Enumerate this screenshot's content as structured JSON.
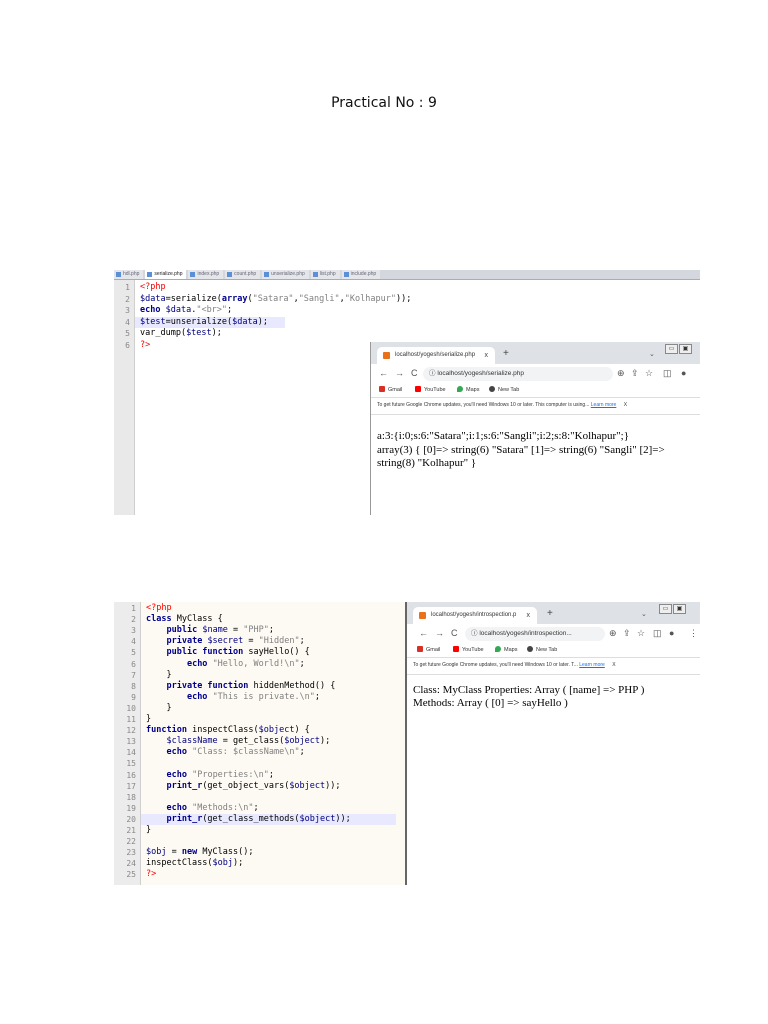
{
  "page": {
    "title": "Practical No : 9"
  },
  "shot1": {
    "editor": {
      "tabs": [
        "hdl.php",
        "serialize.php",
        "index.php",
        "count.php",
        "unserialize.php",
        "list.php",
        "include.php"
      ],
      "active_tab_index": 1,
      "highlight_line": 4,
      "lines": [
        [
          [
            "tag",
            "<?php"
          ]
        ],
        [
          [
            "var",
            "$data"
          ],
          [
            "fn",
            "=serialize("
          ],
          [
            "kw",
            "array"
          ],
          [
            "fn",
            "("
          ],
          [
            "str",
            "\"Satara\""
          ],
          [
            "fn",
            ","
          ],
          [
            "str",
            "\"Sangli\""
          ],
          [
            "fn",
            ","
          ],
          [
            "str",
            "\"Kolhapur\""
          ],
          [
            "fn",
            "));"
          ]
        ],
        [
          [
            "kw",
            "echo"
          ],
          [
            "fn",
            " "
          ],
          [
            "var",
            "$data"
          ],
          [
            "fn",
            "."
          ],
          [
            "str",
            "\"<br>\""
          ],
          [
            "fn",
            ";"
          ]
        ],
        [
          [
            "var",
            "$test"
          ],
          [
            "fn",
            "=unserialize("
          ],
          [
            "var",
            "$data"
          ],
          [
            "fn",
            ");"
          ]
        ],
        [
          [
            "fn",
            "var_dump("
          ],
          [
            "var",
            "$test"
          ],
          [
            "fn",
            ");"
          ]
        ],
        [
          [
            "tag",
            "?>"
          ]
        ]
      ]
    },
    "browser": {
      "tab_title": "localhost/yogesh/serialize.php",
      "tab_close": "x",
      "new_tab": "+",
      "caret": "⌄",
      "url": "localhost/yogesh/serialize.php",
      "nav": {
        "back": "←",
        "forward": "→",
        "reload": "C",
        "info": "ⓘ"
      },
      "toolbar_icons": [
        "⊕",
        "⇪",
        "☆",
        "◫",
        "●"
      ],
      "bookmarks": [
        {
          "label": "Gmail",
          "color": "#d93025"
        },
        {
          "label": "YouTube",
          "color": "#ff0000"
        },
        {
          "label": "Maps",
          "color": "#34a853"
        },
        {
          "label": "New Tab",
          "color": "#444444"
        }
      ],
      "infobar": "To get future Google Chrome updates, you'll need Windows 10 or later. This computer is using...",
      "infobar_link": "Learn more",
      "infobar_close": "X",
      "output": [
        "a:3:{i:0;s:6:\"Satara\";i:1;s:6:\"Sangli\";i:2;s:8:\"Kolhapur\";}",
        "array(3) { [0]=> string(6) \"Satara\" [1]=> string(6) \"Sangli\" [2]=>",
        "string(8) \"Kolhapur\" }"
      ]
    }
  },
  "shot2": {
    "editor": {
      "highlight_line": 20,
      "lines": [
        [
          [
            "tag",
            "<?php"
          ]
        ],
        [
          [
            "kw",
            "class"
          ],
          [
            "fn",
            " MyClass {"
          ]
        ],
        [
          [
            "fn",
            "    "
          ],
          [
            "kw",
            "public"
          ],
          [
            "fn",
            " "
          ],
          [
            "var",
            "$name"
          ],
          [
            "fn",
            " = "
          ],
          [
            "str",
            "\"PHP\""
          ],
          [
            "fn",
            ";"
          ]
        ],
        [
          [
            "fn",
            "    "
          ],
          [
            "kw",
            "private"
          ],
          [
            "fn",
            " "
          ],
          [
            "var",
            "$secret"
          ],
          [
            "fn",
            " = "
          ],
          [
            "str",
            "\"Hidden\""
          ],
          [
            "fn",
            ";"
          ]
        ],
        [
          [
            "fn",
            "    "
          ],
          [
            "kw",
            "public function"
          ],
          [
            "fn",
            " sayHello() {"
          ]
        ],
        [
          [
            "fn",
            "        "
          ],
          [
            "kw",
            "echo"
          ],
          [
            "fn",
            " "
          ],
          [
            "str",
            "\"Hello, World!\\n\""
          ],
          [
            "fn",
            ";"
          ]
        ],
        [
          [
            "fn",
            "    }"
          ]
        ],
        [
          [
            "fn",
            "    "
          ],
          [
            "kw",
            "private function"
          ],
          [
            "fn",
            " hiddenMethod() {"
          ]
        ],
        [
          [
            "fn",
            "        "
          ],
          [
            "kw",
            "echo"
          ],
          [
            "fn",
            " "
          ],
          [
            "str",
            "\"This is private.\\n\""
          ],
          [
            "fn",
            ";"
          ]
        ],
        [
          [
            "fn",
            "    }"
          ]
        ],
        [
          [
            "fn",
            "}"
          ]
        ],
        [
          [
            "kw",
            "function"
          ],
          [
            "fn",
            " inspectClass("
          ],
          [
            "var",
            "$object"
          ],
          [
            "fn",
            ") {"
          ]
        ],
        [
          [
            "fn",
            "    "
          ],
          [
            "var",
            "$className"
          ],
          [
            "fn",
            " = get_class("
          ],
          [
            "var",
            "$object"
          ],
          [
            "fn",
            ");"
          ]
        ],
        [
          [
            "fn",
            "    "
          ],
          [
            "kw",
            "echo"
          ],
          [
            "fn",
            " "
          ],
          [
            "str",
            "\"Class: $className\\n\""
          ],
          [
            "fn",
            ";"
          ]
        ],
        [
          [
            "fn",
            ""
          ]
        ],
        [
          [
            "fn",
            "    "
          ],
          [
            "kw",
            "echo"
          ],
          [
            "fn",
            " "
          ],
          [
            "str",
            "\"Properties:\\n\""
          ],
          [
            "fn",
            ";"
          ]
        ],
        [
          [
            "fn",
            "    "
          ],
          [
            "kw",
            "print_r"
          ],
          [
            "fn",
            "(get_object_vars("
          ],
          [
            "var",
            "$object"
          ],
          [
            "fn",
            "));"
          ]
        ],
        [
          [
            "fn",
            ""
          ]
        ],
        [
          [
            "fn",
            "    "
          ],
          [
            "kw",
            "echo"
          ],
          [
            "fn",
            " "
          ],
          [
            "str",
            "\"Methods:\\n\""
          ],
          [
            "fn",
            ";"
          ]
        ],
        [
          [
            "fn",
            "    "
          ],
          [
            "kw",
            "print_r"
          ],
          [
            "fn",
            "(get_class_methods("
          ],
          [
            "var",
            "$object"
          ],
          [
            "fn",
            "));"
          ]
        ],
        [
          [
            "fn",
            "}"
          ]
        ],
        [
          [
            "fn",
            ""
          ]
        ],
        [
          [
            "var",
            "$obj"
          ],
          [
            "fn",
            " = "
          ],
          [
            "kw",
            "new"
          ],
          [
            "fn",
            " MyClass();"
          ]
        ],
        [
          [
            "fn",
            "inspectClass("
          ],
          [
            "var",
            "$obj"
          ],
          [
            "fn",
            ");"
          ]
        ],
        [
          [
            "tag",
            "?>"
          ]
        ]
      ]
    },
    "browser": {
      "tab_title": "localhost/yogesh/introspection.p",
      "tab_close": "x",
      "new_tab": "+",
      "caret": "⌄",
      "url": "localhost/yogesh/introspection...",
      "nav": {
        "back": "←",
        "forward": "→",
        "reload": "C",
        "info": "ⓘ"
      },
      "toolbar_icons": [
        "⊕",
        "⇪",
        "☆",
        "◫",
        "●",
        "⋮"
      ],
      "bookmarks": [
        {
          "label": "Gmail",
          "color": "#d93025"
        },
        {
          "label": "YouTube",
          "color": "#ff0000"
        },
        {
          "label": "Maps",
          "color": "#34a853"
        },
        {
          "label": "New Tab",
          "color": "#444444"
        }
      ],
      "infobar": "To get future Google Chrome updates, you'll need Windows 10 or later. T...",
      "infobar_link": "Learn more",
      "infobar_close": "X",
      "output": [
        "Class: MyClass Properties: Array ( [name] => PHP )",
        "Methods: Array ( [0] => sayHello )"
      ]
    }
  }
}
